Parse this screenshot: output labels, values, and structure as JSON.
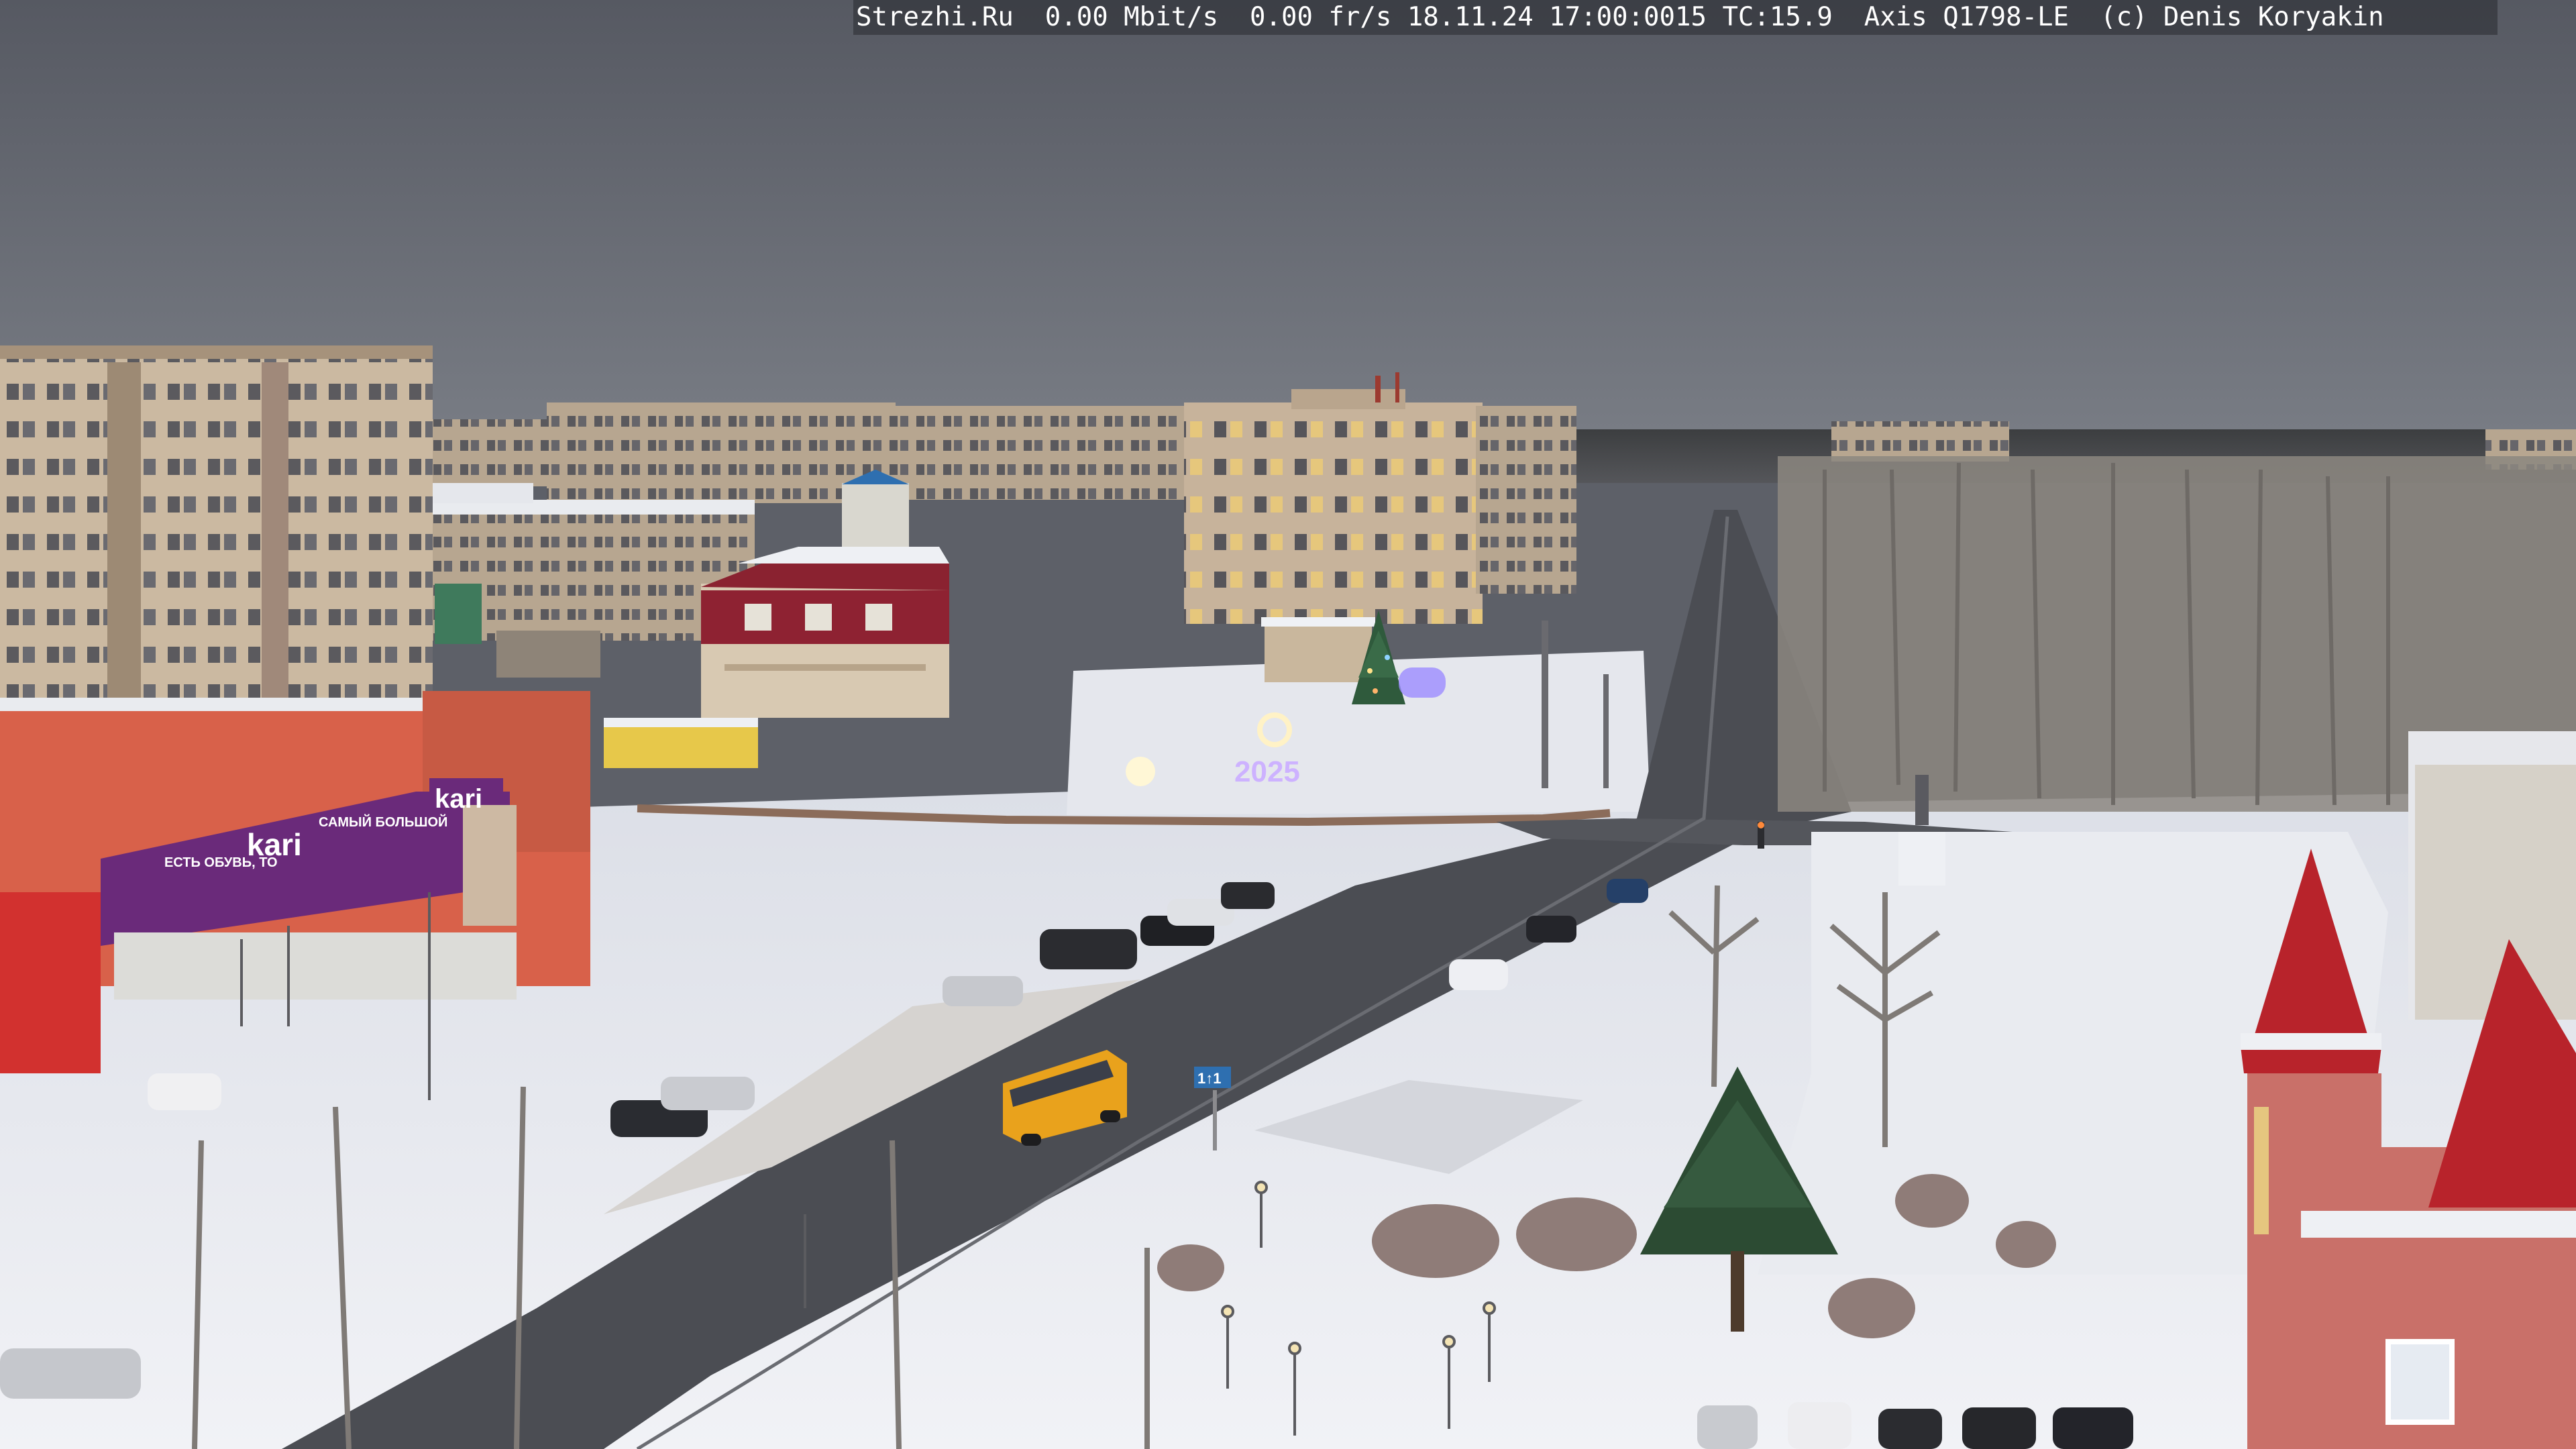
{
  "overlay": {
    "site": "Strezhi.Ru",
    "bitrate": "0.00 Mbit/s",
    "framerate": "0.00 fr/s",
    "timestamp": "18.11.24 17:00:0015",
    "tc": "TC:15.9",
    "camera": "Axis Q1798-LE",
    "credit": "(c) Denis Koryakin"
  },
  "signage": {
    "store_logo": "kari",
    "store_banner_logo": "kari",
    "store_banner_tagline": "ЕСТЬ ОБУВЬ, ТО",
    "store_banner_text": "САМЫЙ БОЛЬШОЙ",
    "new_year_sign": "2025",
    "road_sign": "1↑1"
  },
  "colors": {
    "sky": "#5b5e66",
    "snow": "#eceef3",
    "road": "#4b4d53",
    "roof_red": "#b8232b",
    "store_purple": "#6a2a7a",
    "bus_yellow": "#e9a21c"
  }
}
